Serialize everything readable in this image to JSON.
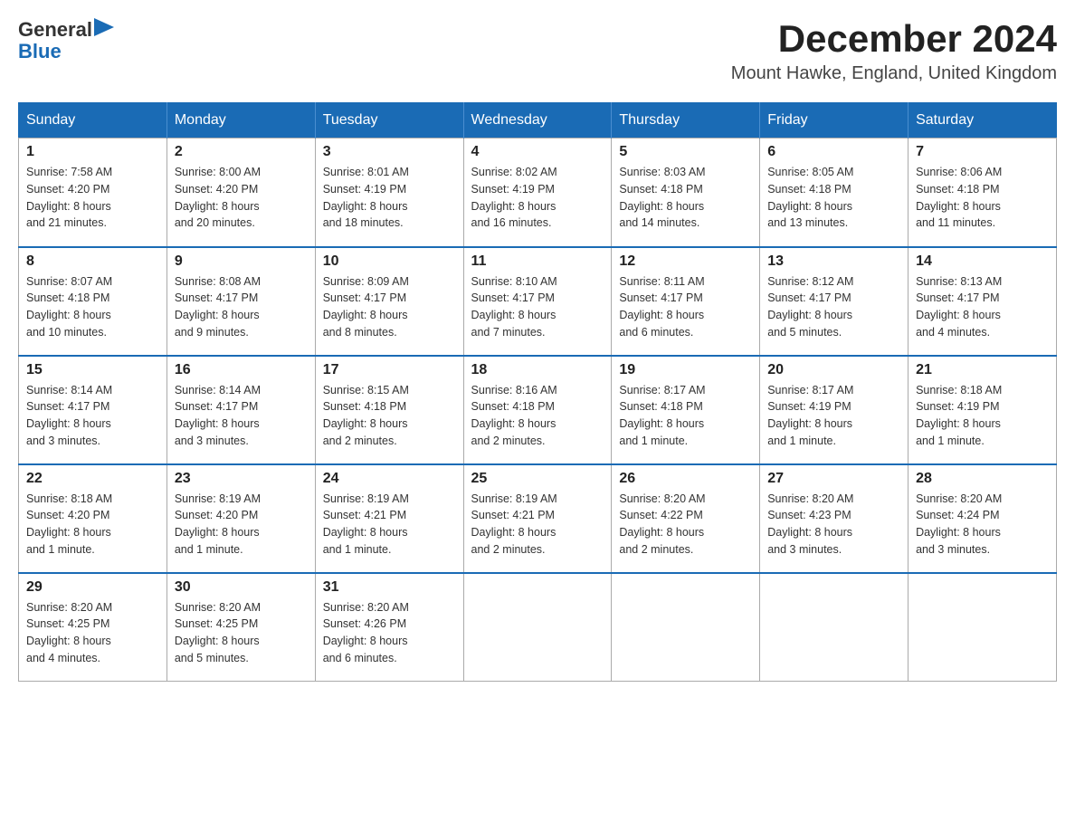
{
  "header": {
    "logo_line1": "General",
    "logo_line2": "Blue",
    "month_title": "December 2024",
    "location": "Mount Hawke, England, United Kingdom"
  },
  "days_of_week": [
    "Sunday",
    "Monday",
    "Tuesday",
    "Wednesday",
    "Thursday",
    "Friday",
    "Saturday"
  ],
  "weeks": [
    [
      {
        "day": "1",
        "sunrise": "7:58 AM",
        "sunset": "4:20 PM",
        "daylight": "8 hours and 21 minutes."
      },
      {
        "day": "2",
        "sunrise": "8:00 AM",
        "sunset": "4:20 PM",
        "daylight": "8 hours and 20 minutes."
      },
      {
        "day": "3",
        "sunrise": "8:01 AM",
        "sunset": "4:19 PM",
        "daylight": "8 hours and 18 minutes."
      },
      {
        "day": "4",
        "sunrise": "8:02 AM",
        "sunset": "4:19 PM",
        "daylight": "8 hours and 16 minutes."
      },
      {
        "day": "5",
        "sunrise": "8:03 AM",
        "sunset": "4:18 PM",
        "daylight": "8 hours and 14 minutes."
      },
      {
        "day": "6",
        "sunrise": "8:05 AM",
        "sunset": "4:18 PM",
        "daylight": "8 hours and 13 minutes."
      },
      {
        "day": "7",
        "sunrise": "8:06 AM",
        "sunset": "4:18 PM",
        "daylight": "8 hours and 11 minutes."
      }
    ],
    [
      {
        "day": "8",
        "sunrise": "8:07 AM",
        "sunset": "4:18 PM",
        "daylight": "8 hours and 10 minutes."
      },
      {
        "day": "9",
        "sunrise": "8:08 AM",
        "sunset": "4:17 PM",
        "daylight": "8 hours and 9 minutes."
      },
      {
        "day": "10",
        "sunrise": "8:09 AM",
        "sunset": "4:17 PM",
        "daylight": "8 hours and 8 minutes."
      },
      {
        "day": "11",
        "sunrise": "8:10 AM",
        "sunset": "4:17 PM",
        "daylight": "8 hours and 7 minutes."
      },
      {
        "day": "12",
        "sunrise": "8:11 AM",
        "sunset": "4:17 PM",
        "daylight": "8 hours and 6 minutes."
      },
      {
        "day": "13",
        "sunrise": "8:12 AM",
        "sunset": "4:17 PM",
        "daylight": "8 hours and 5 minutes."
      },
      {
        "day": "14",
        "sunrise": "8:13 AM",
        "sunset": "4:17 PM",
        "daylight": "8 hours and 4 minutes."
      }
    ],
    [
      {
        "day": "15",
        "sunrise": "8:14 AM",
        "sunset": "4:17 PM",
        "daylight": "8 hours and 3 minutes."
      },
      {
        "day": "16",
        "sunrise": "8:14 AM",
        "sunset": "4:17 PM",
        "daylight": "8 hours and 3 minutes."
      },
      {
        "day": "17",
        "sunrise": "8:15 AM",
        "sunset": "4:18 PM",
        "daylight": "8 hours and 2 minutes."
      },
      {
        "day": "18",
        "sunrise": "8:16 AM",
        "sunset": "4:18 PM",
        "daylight": "8 hours and 2 minutes."
      },
      {
        "day": "19",
        "sunrise": "8:17 AM",
        "sunset": "4:18 PM",
        "daylight": "8 hours and 1 minute."
      },
      {
        "day": "20",
        "sunrise": "8:17 AM",
        "sunset": "4:19 PM",
        "daylight": "8 hours and 1 minute."
      },
      {
        "day": "21",
        "sunrise": "8:18 AM",
        "sunset": "4:19 PM",
        "daylight": "8 hours and 1 minute."
      }
    ],
    [
      {
        "day": "22",
        "sunrise": "8:18 AM",
        "sunset": "4:20 PM",
        "daylight": "8 hours and 1 minute."
      },
      {
        "day": "23",
        "sunrise": "8:19 AM",
        "sunset": "4:20 PM",
        "daylight": "8 hours and 1 minute."
      },
      {
        "day": "24",
        "sunrise": "8:19 AM",
        "sunset": "4:21 PM",
        "daylight": "8 hours and 1 minute."
      },
      {
        "day": "25",
        "sunrise": "8:19 AM",
        "sunset": "4:21 PM",
        "daylight": "8 hours and 2 minutes."
      },
      {
        "day": "26",
        "sunrise": "8:20 AM",
        "sunset": "4:22 PM",
        "daylight": "8 hours and 2 minutes."
      },
      {
        "day": "27",
        "sunrise": "8:20 AM",
        "sunset": "4:23 PM",
        "daylight": "8 hours and 3 minutes."
      },
      {
        "day": "28",
        "sunrise": "8:20 AM",
        "sunset": "4:24 PM",
        "daylight": "8 hours and 3 minutes."
      }
    ],
    [
      {
        "day": "29",
        "sunrise": "8:20 AM",
        "sunset": "4:25 PM",
        "daylight": "8 hours and 4 minutes."
      },
      {
        "day": "30",
        "sunrise": "8:20 AM",
        "sunset": "4:25 PM",
        "daylight": "8 hours and 5 minutes."
      },
      {
        "day": "31",
        "sunrise": "8:20 AM",
        "sunset": "4:26 PM",
        "daylight": "8 hours and 6 minutes."
      },
      null,
      null,
      null,
      null
    ]
  ],
  "labels": {
    "sunrise": "Sunrise:",
    "sunset": "Sunset:",
    "daylight": "Daylight:"
  }
}
